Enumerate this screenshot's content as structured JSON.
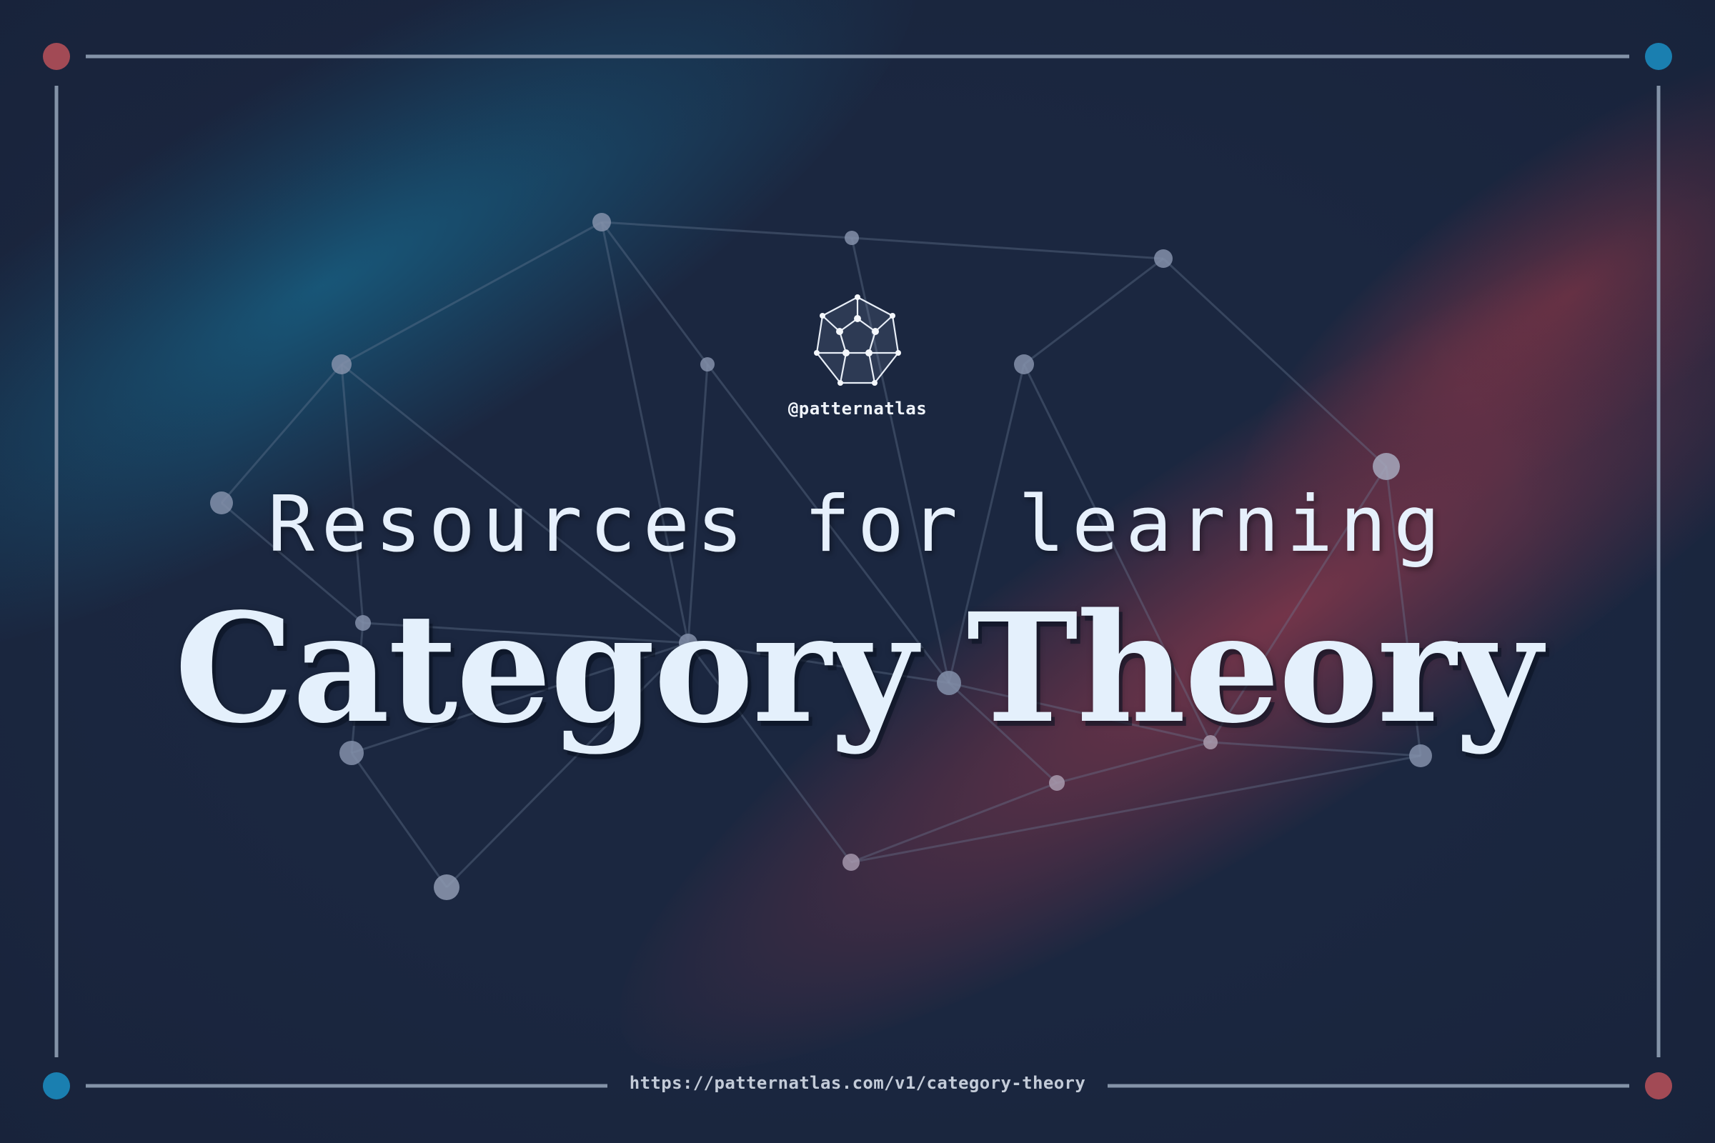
{
  "header": {
    "handle": "@patternatlas"
  },
  "title": {
    "line1": "Resources for learning",
    "line2": "Category Theory"
  },
  "footer": {
    "url": "https://patternatlas.com/v1/category-theory"
  },
  "icons": {
    "logo": "dodecahedron-graph-icon",
    "corners": [
      "corner-dot-red",
      "corner-dot-blue",
      "corner-dot-blue",
      "corner-dot-red"
    ]
  },
  "colors": {
    "background": "#1b2740",
    "accent_blue": "#1a7fb0",
    "accent_red": "#9c4a58",
    "frame_line": "#7f8da4",
    "text": "#e6f0fc",
    "node": "#7d8aa5"
  }
}
